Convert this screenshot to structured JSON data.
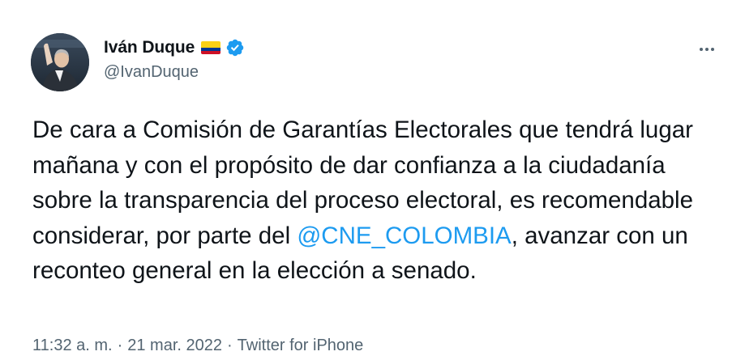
{
  "author": {
    "display_name": "Iván Duque",
    "handle": "@IvanDuque",
    "flag_icon": "colombia-flag-icon",
    "verified_icon": "verified-badge-icon"
  },
  "more_icon": "more-horizontal-icon",
  "tweet": {
    "text_before_mention": "De cara a Comisión de Garantías Electorales que tendrá lugar mañana y con el propósito de dar confianza a la ciudadanía sobre la transparencia del proceso electoral, es recomendable considerar, por parte del ",
    "mention": "@CNE_COLOMBIA",
    "text_after_mention": ", avanzar con un reconteo general en la elección a senado."
  },
  "meta": {
    "time": "11:32 a. m.",
    "separator": "·",
    "date": "21 mar. 2022",
    "source": "Twitter for iPhone"
  },
  "colors": {
    "text": "#0f1419",
    "secondary": "#536471",
    "accent": "#1d9bf0",
    "flag_yellow": "#FCD116",
    "flag_blue": "#003893",
    "flag_red": "#CE1126"
  }
}
